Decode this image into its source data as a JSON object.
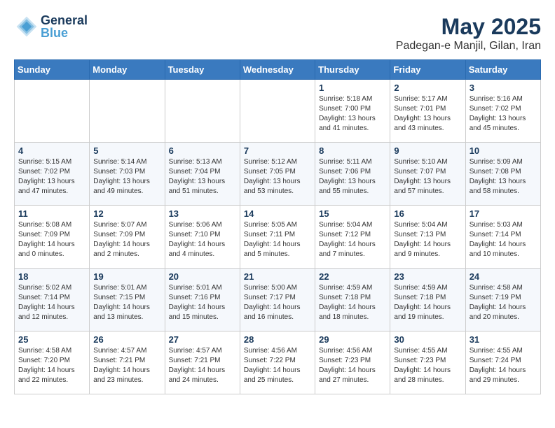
{
  "header": {
    "logo_general": "General",
    "logo_blue": "Blue",
    "month_year": "May 2025",
    "location": "Padegan-e Manjil, Gilan, Iran"
  },
  "weekdays": [
    "Sunday",
    "Monday",
    "Tuesday",
    "Wednesday",
    "Thursday",
    "Friday",
    "Saturday"
  ],
  "weeks": [
    [
      {
        "day": "",
        "info": ""
      },
      {
        "day": "",
        "info": ""
      },
      {
        "day": "",
        "info": ""
      },
      {
        "day": "",
        "info": ""
      },
      {
        "day": "1",
        "info": "Sunrise: 5:18 AM\nSunset: 7:00 PM\nDaylight: 13 hours\nand 41 minutes."
      },
      {
        "day": "2",
        "info": "Sunrise: 5:17 AM\nSunset: 7:01 PM\nDaylight: 13 hours\nand 43 minutes."
      },
      {
        "day": "3",
        "info": "Sunrise: 5:16 AM\nSunset: 7:02 PM\nDaylight: 13 hours\nand 45 minutes."
      }
    ],
    [
      {
        "day": "4",
        "info": "Sunrise: 5:15 AM\nSunset: 7:02 PM\nDaylight: 13 hours\nand 47 minutes."
      },
      {
        "day": "5",
        "info": "Sunrise: 5:14 AM\nSunset: 7:03 PM\nDaylight: 13 hours\nand 49 minutes."
      },
      {
        "day": "6",
        "info": "Sunrise: 5:13 AM\nSunset: 7:04 PM\nDaylight: 13 hours\nand 51 minutes."
      },
      {
        "day": "7",
        "info": "Sunrise: 5:12 AM\nSunset: 7:05 PM\nDaylight: 13 hours\nand 53 minutes."
      },
      {
        "day": "8",
        "info": "Sunrise: 5:11 AM\nSunset: 7:06 PM\nDaylight: 13 hours\nand 55 minutes."
      },
      {
        "day": "9",
        "info": "Sunrise: 5:10 AM\nSunset: 7:07 PM\nDaylight: 13 hours\nand 57 minutes."
      },
      {
        "day": "10",
        "info": "Sunrise: 5:09 AM\nSunset: 7:08 PM\nDaylight: 13 hours\nand 58 minutes."
      }
    ],
    [
      {
        "day": "11",
        "info": "Sunrise: 5:08 AM\nSunset: 7:09 PM\nDaylight: 14 hours\nand 0 minutes."
      },
      {
        "day": "12",
        "info": "Sunrise: 5:07 AM\nSunset: 7:09 PM\nDaylight: 14 hours\nand 2 minutes."
      },
      {
        "day": "13",
        "info": "Sunrise: 5:06 AM\nSunset: 7:10 PM\nDaylight: 14 hours\nand 4 minutes."
      },
      {
        "day": "14",
        "info": "Sunrise: 5:05 AM\nSunset: 7:11 PM\nDaylight: 14 hours\nand 5 minutes."
      },
      {
        "day": "15",
        "info": "Sunrise: 5:04 AM\nSunset: 7:12 PM\nDaylight: 14 hours\nand 7 minutes."
      },
      {
        "day": "16",
        "info": "Sunrise: 5:04 AM\nSunset: 7:13 PM\nDaylight: 14 hours\nand 9 minutes."
      },
      {
        "day": "17",
        "info": "Sunrise: 5:03 AM\nSunset: 7:14 PM\nDaylight: 14 hours\nand 10 minutes."
      }
    ],
    [
      {
        "day": "18",
        "info": "Sunrise: 5:02 AM\nSunset: 7:14 PM\nDaylight: 14 hours\nand 12 minutes."
      },
      {
        "day": "19",
        "info": "Sunrise: 5:01 AM\nSunset: 7:15 PM\nDaylight: 14 hours\nand 13 minutes."
      },
      {
        "day": "20",
        "info": "Sunrise: 5:01 AM\nSunset: 7:16 PM\nDaylight: 14 hours\nand 15 minutes."
      },
      {
        "day": "21",
        "info": "Sunrise: 5:00 AM\nSunset: 7:17 PM\nDaylight: 14 hours\nand 16 minutes."
      },
      {
        "day": "22",
        "info": "Sunrise: 4:59 AM\nSunset: 7:18 PM\nDaylight: 14 hours\nand 18 minutes."
      },
      {
        "day": "23",
        "info": "Sunrise: 4:59 AM\nSunset: 7:18 PM\nDaylight: 14 hours\nand 19 minutes."
      },
      {
        "day": "24",
        "info": "Sunrise: 4:58 AM\nSunset: 7:19 PM\nDaylight: 14 hours\nand 20 minutes."
      }
    ],
    [
      {
        "day": "25",
        "info": "Sunrise: 4:58 AM\nSunset: 7:20 PM\nDaylight: 14 hours\nand 22 minutes."
      },
      {
        "day": "26",
        "info": "Sunrise: 4:57 AM\nSunset: 7:21 PM\nDaylight: 14 hours\nand 23 minutes."
      },
      {
        "day": "27",
        "info": "Sunrise: 4:57 AM\nSunset: 7:21 PM\nDaylight: 14 hours\nand 24 minutes."
      },
      {
        "day": "28",
        "info": "Sunrise: 4:56 AM\nSunset: 7:22 PM\nDaylight: 14 hours\nand 25 minutes."
      },
      {
        "day": "29",
        "info": "Sunrise: 4:56 AM\nSunset: 7:23 PM\nDaylight: 14 hours\nand 27 minutes."
      },
      {
        "day": "30",
        "info": "Sunrise: 4:55 AM\nSunset: 7:23 PM\nDaylight: 14 hours\nand 28 minutes."
      },
      {
        "day": "31",
        "info": "Sunrise: 4:55 AM\nSunset: 7:24 PM\nDaylight: 14 hours\nand 29 minutes."
      }
    ]
  ]
}
